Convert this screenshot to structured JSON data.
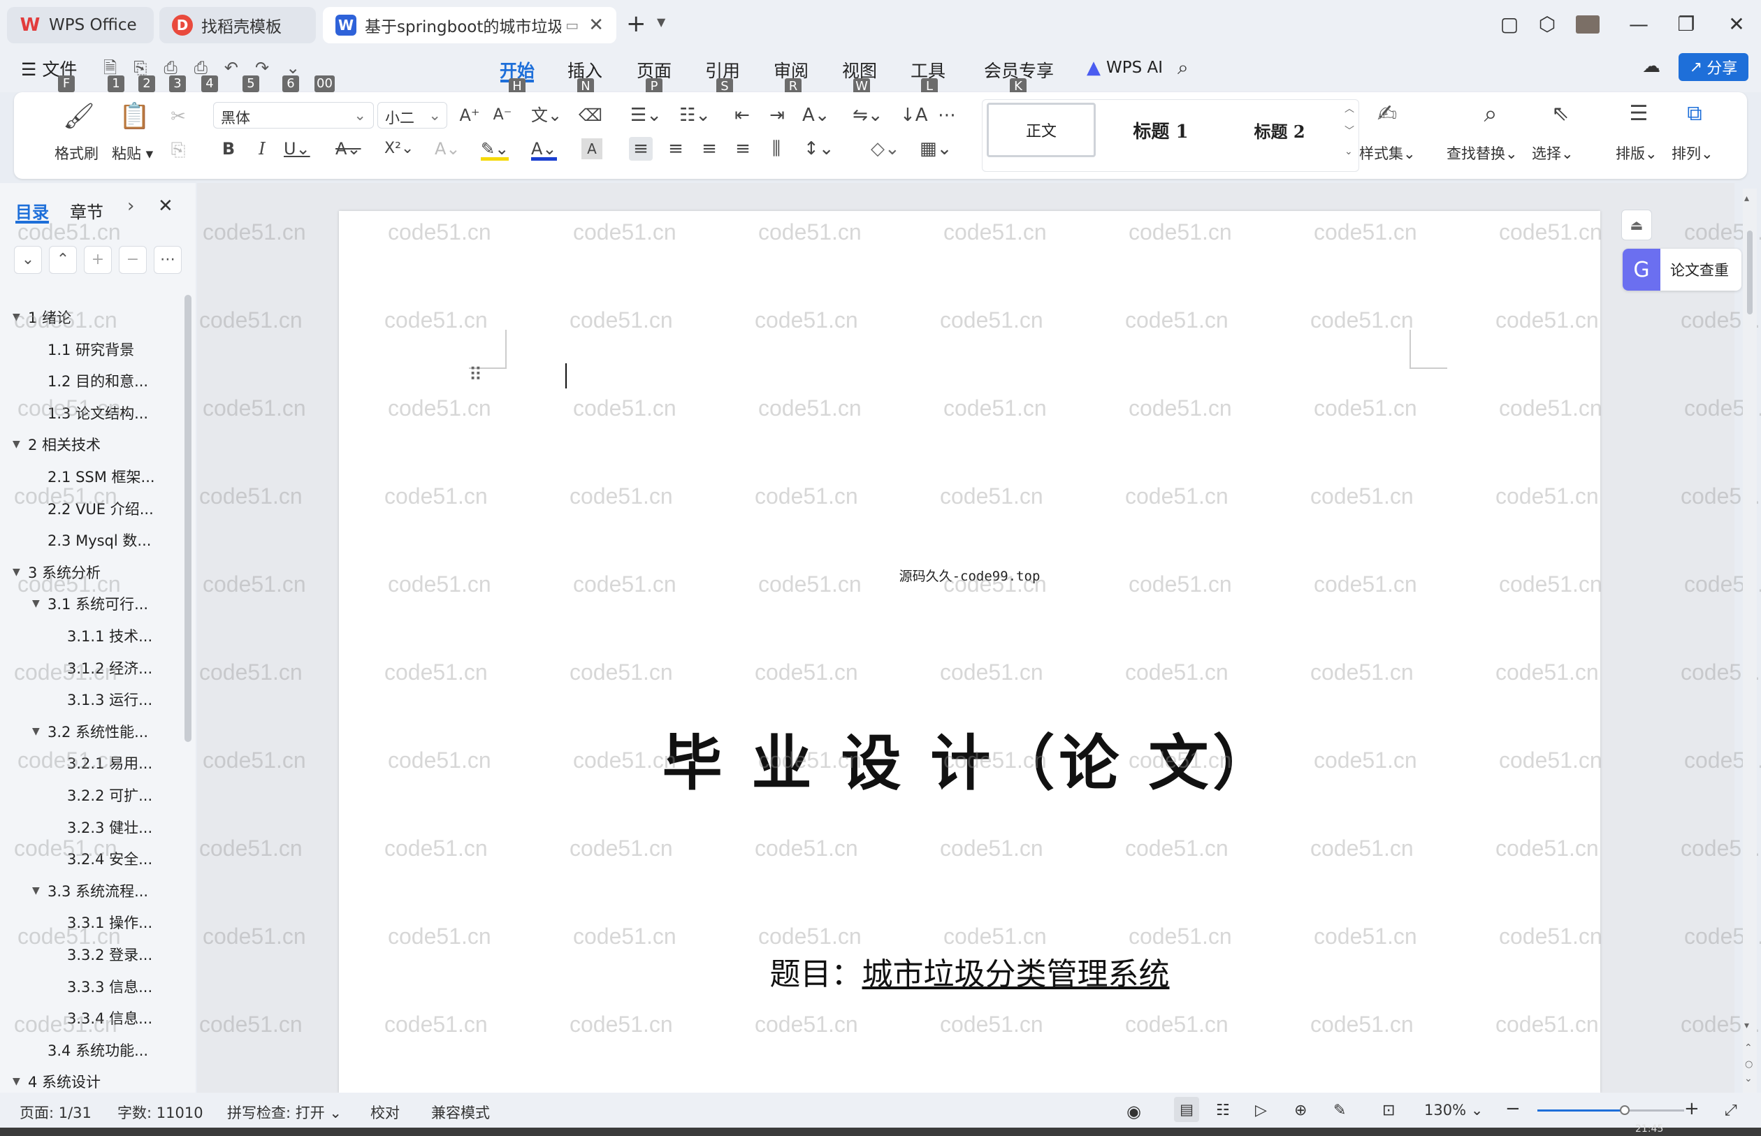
{
  "titlebar": {
    "tabs": [
      {
        "label": "WPS Office",
        "icon": "wps-logo-icon"
      },
      {
        "label": "找稻壳模板",
        "icon": "docer-icon"
      },
      {
        "label": "基于springboot的城市垃圾分",
        "icon": "word-doc-icon"
      }
    ],
    "new_tab": "+"
  },
  "menu": {
    "file": "文件",
    "tabs": [
      "开始",
      "插入",
      "页面",
      "引用",
      "审阅",
      "视图",
      "工具",
      "会员专享"
    ],
    "active_tab": "开始",
    "keytips": [
      "H",
      "N",
      "P",
      "S",
      "R",
      "W",
      "L",
      "K"
    ],
    "qa_keytips": [
      "F",
      "1",
      "2",
      "3",
      "4",
      "5",
      "6",
      "00"
    ],
    "wps_ai": "WPS AI",
    "share": "分享"
  },
  "ribbon": {
    "format_painter": "格式刷",
    "paste": "粘贴",
    "font_name": "黑体",
    "font_size": "小二",
    "styles": [
      "正文",
      "标题 1",
      "标题 2"
    ],
    "style_set": "样式集",
    "find_replace": "查找替换",
    "select": "选择",
    "layout": "排版",
    "arrange": "排列",
    "colors": {
      "accent": "#1e6fd9",
      "highlight": "#f5d90a",
      "font_color": "#1a3fd0",
      "wps_red": "#e23c3c"
    }
  },
  "panel": {
    "tab_toc": "目录",
    "tab_chapter": "章节",
    "toc": [
      {
        "label": "1  绪论",
        "level": 1,
        "expand": true
      },
      {
        "label": "1.1  研究背景",
        "level": 2
      },
      {
        "label": "1.2  目的和意...",
        "level": 2
      },
      {
        "label": "1.3  论文结构...",
        "level": 2
      },
      {
        "label": "2  相关技术",
        "level": 1,
        "expand": true
      },
      {
        "label": "2.1 SSM 框架...",
        "level": 2
      },
      {
        "label": "2.2 VUE 介绍...",
        "level": 2
      },
      {
        "label": "2.3 Mysql 数...",
        "level": 2
      },
      {
        "label": "3  系统分析",
        "level": 1,
        "expand": true
      },
      {
        "label": "3.1  系统可行...",
        "level": 2,
        "expand": true
      },
      {
        "label": "3.1.1  技术...",
        "level": 3
      },
      {
        "label": "3.1.2  经济...",
        "level": 3
      },
      {
        "label": "3.1.3  运行...",
        "level": 3
      },
      {
        "label": "3.2  系统性能...",
        "level": 2,
        "expand": true
      },
      {
        "label": "3.2.1  易用...",
        "level": 3
      },
      {
        "label": "3.2.2  可扩...",
        "level": 3
      },
      {
        "label": "3.2.3  健壮...",
        "level": 3
      },
      {
        "label": "3.2.4  安全...",
        "level": 3
      },
      {
        "label": "3.3  系统流程...",
        "level": 2,
        "expand": true
      },
      {
        "label": "3.3.1  操作...",
        "level": 3
      },
      {
        "label": "3.3.2  登录...",
        "level": 3
      },
      {
        "label": "3.3.3  信息...",
        "level": 3
      },
      {
        "label": "3.3.4  信息...",
        "level": 3
      },
      {
        "label": "3.4  系统功能...",
        "level": 2
      },
      {
        "label": "4  系统设计",
        "level": 1,
        "expand": true
      }
    ]
  },
  "document": {
    "source_line": "源码久久-code99.top",
    "title": "毕 业 设 计（论 文）",
    "subject_label": "题目：",
    "subject_value": "城市垃圾分类管理系统",
    "watermark": "code51.cn"
  },
  "right_panel": {
    "plagiarism_check": "论文查重"
  },
  "status": {
    "page": "页面: 1/31",
    "words": "字数: 11010",
    "spellcheck": "拼写检查: 打开",
    "proof": "校对",
    "compat": "兼容模式",
    "zoom": "130%",
    "zoom_fraction": 0.6,
    "clock": "21:45"
  }
}
